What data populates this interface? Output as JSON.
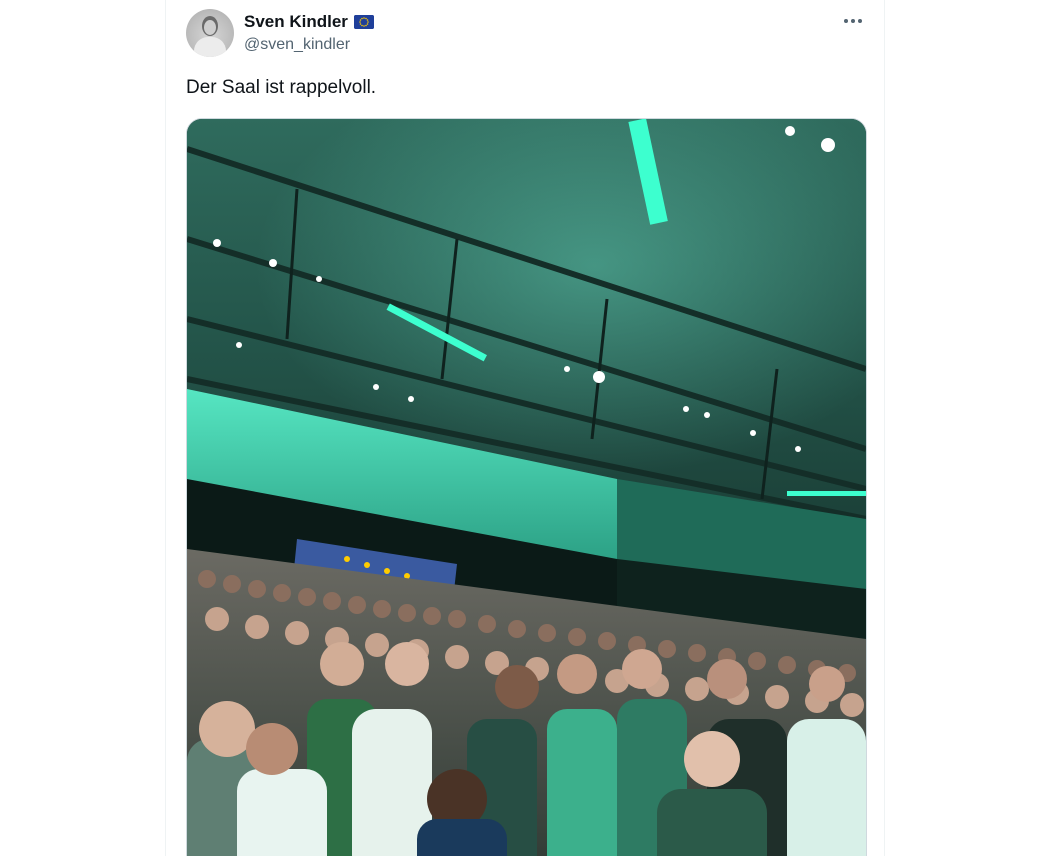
{
  "author": {
    "display_name": "Sven Kindler",
    "handle": "@sven_kindler",
    "badge_icon": "eu-flag-icon",
    "avatar_icon": "profile-avatar"
  },
  "tweet": {
    "text": "Der Saal ist rappelvoll."
  },
  "actions": {
    "more_icon": "more-options-icon"
  },
  "media": {
    "kind": "photo",
    "subject": "crowded hall with green stage lighting"
  },
  "colors": {
    "text_primary": "#0f1419",
    "text_secondary": "#536471",
    "border": "#eff3f4",
    "eu_blue": "#1f3f9a",
    "eu_gold": "#ffcc00",
    "stage_green": "#3de0b0"
  }
}
